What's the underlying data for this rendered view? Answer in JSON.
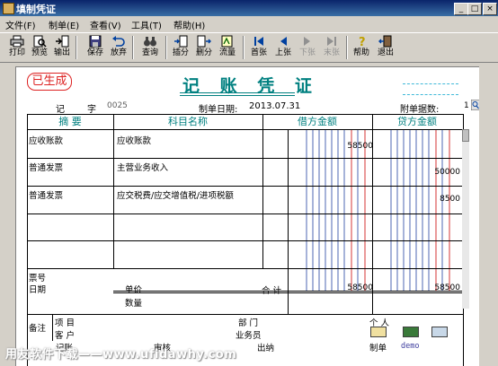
{
  "window": {
    "title": "填制凭证",
    "minimize": "_",
    "maximize": "□",
    "close": "×"
  },
  "menu": [
    "文件(F)",
    "制单(E)",
    "查看(V)",
    "工具(T)",
    "帮助(H)"
  ],
  "toolbar": [
    "打印",
    "预览",
    "输出",
    "保存",
    "放弃",
    "查询",
    "插分",
    "删分",
    "流量",
    "首张",
    "上张",
    "下张",
    "末张",
    "帮助",
    "退出"
  ],
  "voucher": {
    "status_stamp": "已生成",
    "title": "记 账 凭 证",
    "type_char": "记",
    "zi": "字",
    "number": "0025",
    "date_label": "制单日期:",
    "date": "2013.07.31",
    "attach_label": "附单据数:",
    "attach_count": "1",
    "headers": {
      "summary": "摘 要",
      "account": "科目名称",
      "debit": "借方金额",
      "credit": "贷方金额"
    },
    "rows": [
      {
        "summary": "应收账款",
        "account": "应收账款",
        "debit": "58500",
        "credit": ""
      },
      {
        "summary": "普通发票",
        "account": "主营业务收入",
        "debit": "",
        "credit": "50000"
      },
      {
        "summary": "普通发票",
        "account": "应交税费/应交增值税/进项税额",
        "debit": "",
        "credit": "8500"
      },
      {
        "summary": "",
        "account": "",
        "debit": "",
        "credit": ""
      },
      {
        "summary": "",
        "account": "",
        "debit": "",
        "credit": ""
      }
    ],
    "bill_no_label": "票号",
    "date_field_label": "日期",
    "price_label": "单价",
    "qty_label": "数量",
    "total_label": "合 计",
    "total_debit": "58500",
    "total_credit": "58500",
    "remark_label": "备注",
    "project_label": "项  目",
    "customer_label": "客  户",
    "dept_label": "部  门",
    "person_label": "个  人",
    "salesman_label": "业务员",
    "footer": {
      "bookkeep": "记账",
      "audit": "审核",
      "cashier": "出纳",
      "maker": "制单",
      "maker_name": "demo"
    }
  },
  "watermark": "用友软件下载——www.ufidawhy.com"
}
